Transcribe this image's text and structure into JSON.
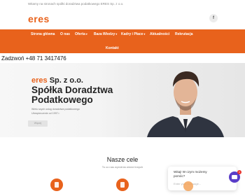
{
  "topbar": {
    "welcome_text": "Witamy na stronach spółki doradztwa podatkowego ERES Sp. z o.o."
  },
  "header": {
    "logo_text": "eres",
    "facebook_label": "f"
  },
  "nav": {
    "items": [
      {
        "label": "Strona główna",
        "has_dropdown": false
      },
      {
        "label": "O nas",
        "has_dropdown": false
      },
      {
        "label": "Oferta",
        "has_dropdown": true
      },
      {
        "label": "Baza Wiedzy",
        "has_dropdown": true
      },
      {
        "label": "Kadry i Płace",
        "has_dropdown": true
      },
      {
        "label": "Aktualności",
        "has_dropdown": false
      },
      {
        "label": "Rekrutacja",
        "has_dropdown": false
      }
    ],
    "dropdown_symbol": "▾",
    "contact_label": "Kontakt"
  },
  "phone_text": "Zadzwoń +48 71 3417476",
  "hero": {
    "brand_prefix": "eres",
    "brand_suffix": " Sp. z o.o.",
    "title": "Spółka Doradztwa Podatkowego",
    "sub_line_1": "Wielu szych usług doradztwa podatkowego",
    "sub_line_2": "Ubezpieczenie od 1997 r.",
    "button_label": "Więcej"
  },
  "goals": {
    "title": "Nasze cele",
    "subtitle": "To co nas wyróżnia wśród innych"
  },
  "chat": {
    "question": "Witaj! W czym możemy pomóc?",
    "input_placeholder": "Enter your message...",
    "badge_count": "1"
  },
  "colors": {
    "accent": "#e8621c",
    "chat": "#5a3dc8"
  }
}
